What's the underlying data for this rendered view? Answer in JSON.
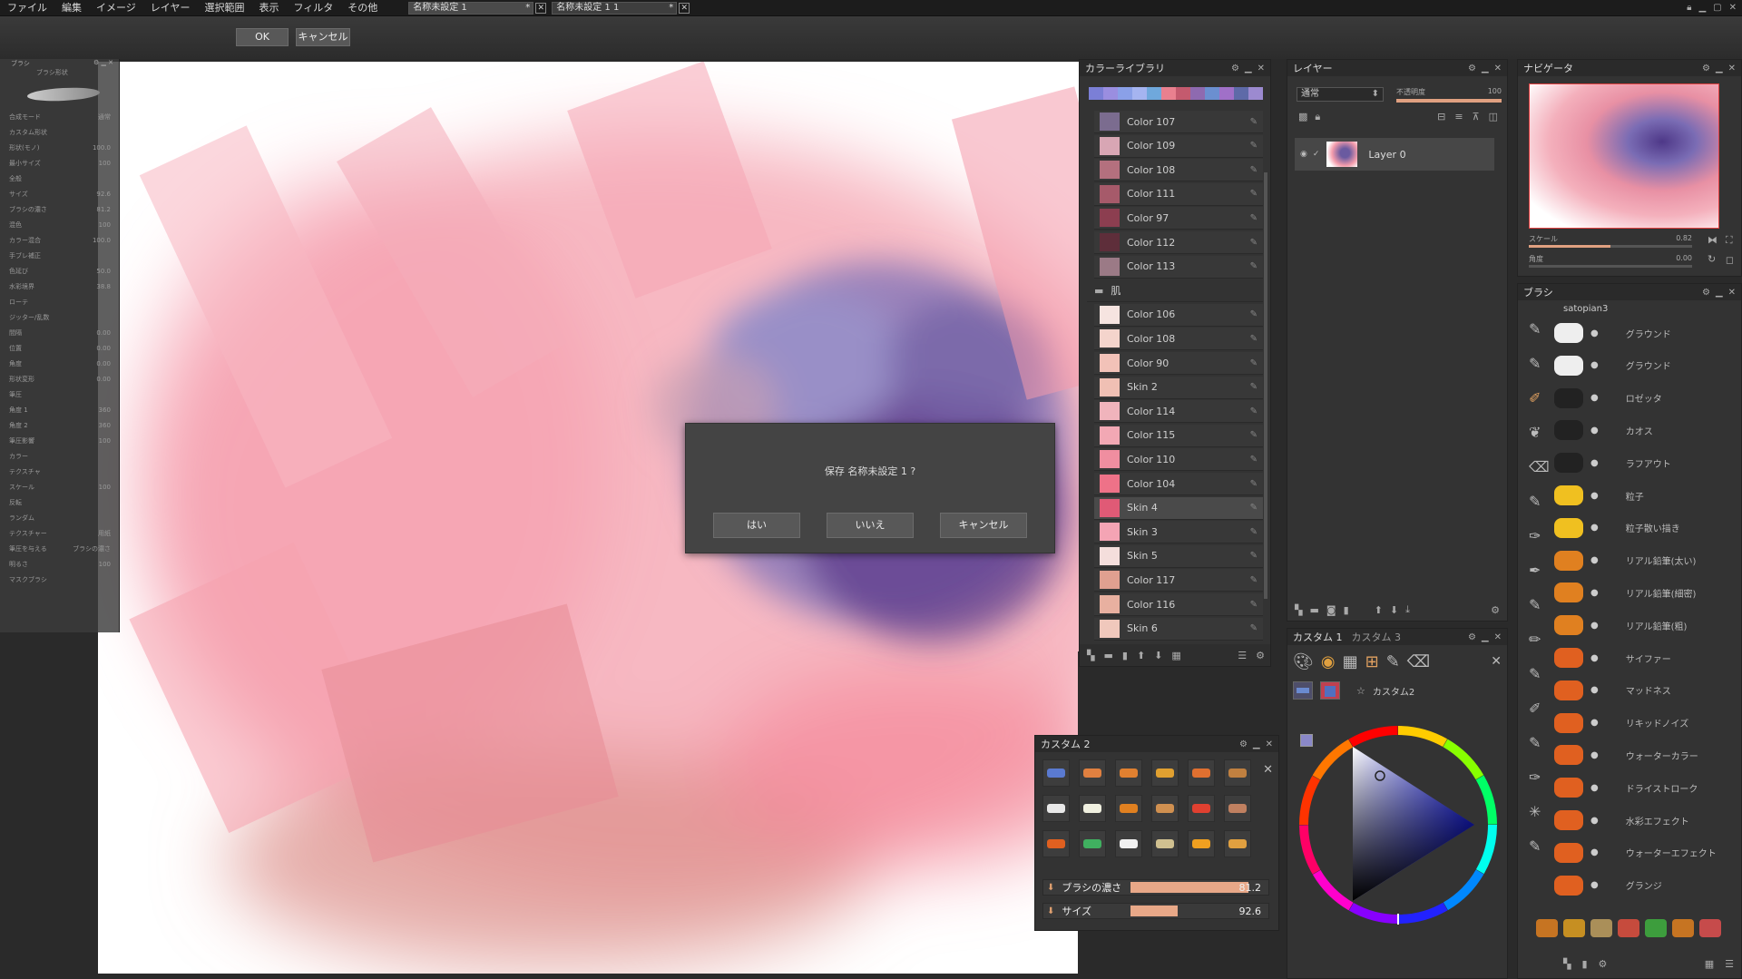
{
  "menu": [
    "ファイル",
    "編集",
    "イメージ",
    "レイヤー",
    "選択範囲",
    "表示",
    "フィルタ",
    "その他"
  ],
  "doc_tabs": [
    {
      "label": "名称未設定 1",
      "active": true,
      "marker": "*"
    },
    {
      "label": "名称未設定 1 1",
      "active": false,
      "marker": "*"
    }
  ],
  "toolbar": {
    "ok_label": "OK",
    "cancel_label": "キャンセル"
  },
  "brush_properties": {
    "title": "ブラシ",
    "subtitle": "ブラシ形状",
    "rows": [
      {
        "label": "合成モード",
        "value": "通常"
      },
      {
        "label": "カスタム形状",
        "value": ""
      },
      {
        "label": "形状(モノ)",
        "value": "100.0"
      },
      {
        "label": "最小サイズ",
        "value": "100"
      },
      {
        "label": "全般",
        "value": ""
      },
      {
        "label": "サイズ",
        "value": "92.6"
      },
      {
        "label": "ブラシの濃さ",
        "value": "81.2"
      },
      {
        "label": "混色",
        "value": "100"
      },
      {
        "label": "カラー混合",
        "value": "100.0"
      },
      {
        "label": "手ブレ補正",
        "value": ""
      },
      {
        "label": "色延び",
        "value": "50.0"
      },
      {
        "label": "水彩境界",
        "value": "38.8"
      },
      {
        "label": "ローテ",
        "value": ""
      },
      {
        "label": "ジッター/乱数",
        "value": ""
      },
      {
        "label": "間隔",
        "value": "0.00"
      },
      {
        "label": "位置",
        "value": "0.00"
      },
      {
        "label": "角度",
        "value": "0.00"
      },
      {
        "label": "形状変形",
        "value": "0.00"
      },
      {
        "label": "筆圧",
        "value": ""
      },
      {
        "label": "角度 1",
        "value": "360"
      },
      {
        "label": "角度 2",
        "value": "360"
      },
      {
        "label": "筆圧影響",
        "value": "100"
      },
      {
        "label": "カラー",
        "value": ""
      },
      {
        "label": "テクスチャ",
        "value": ""
      },
      {
        "label": "スケール",
        "value": "100"
      },
      {
        "label": "反転",
        "value": ""
      },
      {
        "label": "ランダム",
        "value": ""
      },
      {
        "label": "テクスチャー",
        "value": "用紙"
      },
      {
        "label": "筆圧を与える",
        "value": "ブラシの濃さ"
      },
      {
        "label": "明るさ",
        "value": "100"
      },
      {
        "label": "マスクブラシ",
        "value": ""
      }
    ]
  },
  "color_library": {
    "title": "カラーライブラリ",
    "strip": [
      "#7b7fd6",
      "#9a8ee0",
      "#8aa0e8",
      "#a5b4f0",
      "#6fa8dc",
      "#e9808f",
      "#c45a6e",
      "#8e6ab0",
      "#6b8fd0",
      "#a070c8",
      "#5e6aa8",
      "#9c8ad0"
    ],
    "group1": [
      {
        "name": "Color 107",
        "color": "#7b6c8f"
      },
      {
        "name": "Color 109",
        "color": "#d8a6b4"
      },
      {
        "name": "Color 108",
        "color": "#b4707e"
      },
      {
        "name": "Color 111",
        "color": "#a65a6a"
      },
      {
        "name": "Color 97",
        "color": "#8c3e50"
      },
      {
        "name": "Color 112",
        "color": "#5e2e3a"
      },
      {
        "name": "Color 113",
        "color": "#9b7a86"
      }
    ],
    "group_label": "肌",
    "group2": [
      {
        "name": "Color 106",
        "color": "#f6e4e0"
      },
      {
        "name": "Color 108",
        "color": "#f4d4cc"
      },
      {
        "name": "Color 90",
        "color": "#f2c2b8"
      },
      {
        "name": "Skin 2",
        "color": "#f0c0b4"
      },
      {
        "name": "Color 114",
        "color": "#f0b4bc"
      },
      {
        "name": "Color 115",
        "color": "#f2a8b4"
      },
      {
        "name": "Color 110",
        "color": "#f08ea0"
      },
      {
        "name": "Color 104",
        "color": "#ee7288"
      },
      {
        "name": "Skin 4",
        "color": "#e05a76"
      },
      {
        "name": "Skin 3",
        "color": "#f4a4b4"
      },
      {
        "name": "Skin 5",
        "color": "#f4dedc"
      },
      {
        "name": "Color 117",
        "color": "#e0a090"
      },
      {
        "name": "Color 116",
        "color": "#e8b0a0"
      },
      {
        "name": "Skin 6",
        "color": "#f0c8bc"
      }
    ]
  },
  "layers": {
    "title": "レイヤー",
    "blend": "通常",
    "opacity_label": "不透明度",
    "opacity_value": "100",
    "items": [
      {
        "name": "Layer 0"
      }
    ]
  },
  "navigator": {
    "title": "ナビゲータ",
    "scale_label": "スケール",
    "scale_value": "0.82",
    "angle_label": "角度",
    "angle_value": "0.00"
  },
  "brushes": {
    "title": "ブラシ",
    "set_name": "satopian3",
    "items": [
      "グラウンド",
      "グラウンド",
      "ロゼッタ",
      "カオス",
      "ラフアウト",
      "粒子",
      "粒子散い描き",
      "リアル鉛筆(太い)",
      "リアル鉛筆(細密)",
      "リアル鉛筆(粗)",
      "サイファー",
      "マッドネス",
      "リキッドノイズ",
      "ウォーターカラー",
      "ドライストローク",
      "水彩エフェクト",
      "ウォーターエフェクト",
      "グランジ"
    ]
  },
  "custom_panel": {
    "tabs": [
      "カスタム 1",
      "カスタム 3"
    ],
    "preset_label": "カスタム2"
  },
  "custom2": {
    "title": "カスタム 2",
    "density_label": "ブラシの濃さ",
    "density_value": "81.2",
    "size_label": "サイズ",
    "size_value": "92.6"
  },
  "dialog": {
    "message": "保存 名称未設定 1 ?",
    "yes": "はい",
    "no": "いいえ",
    "cancel": "キャンセル"
  }
}
